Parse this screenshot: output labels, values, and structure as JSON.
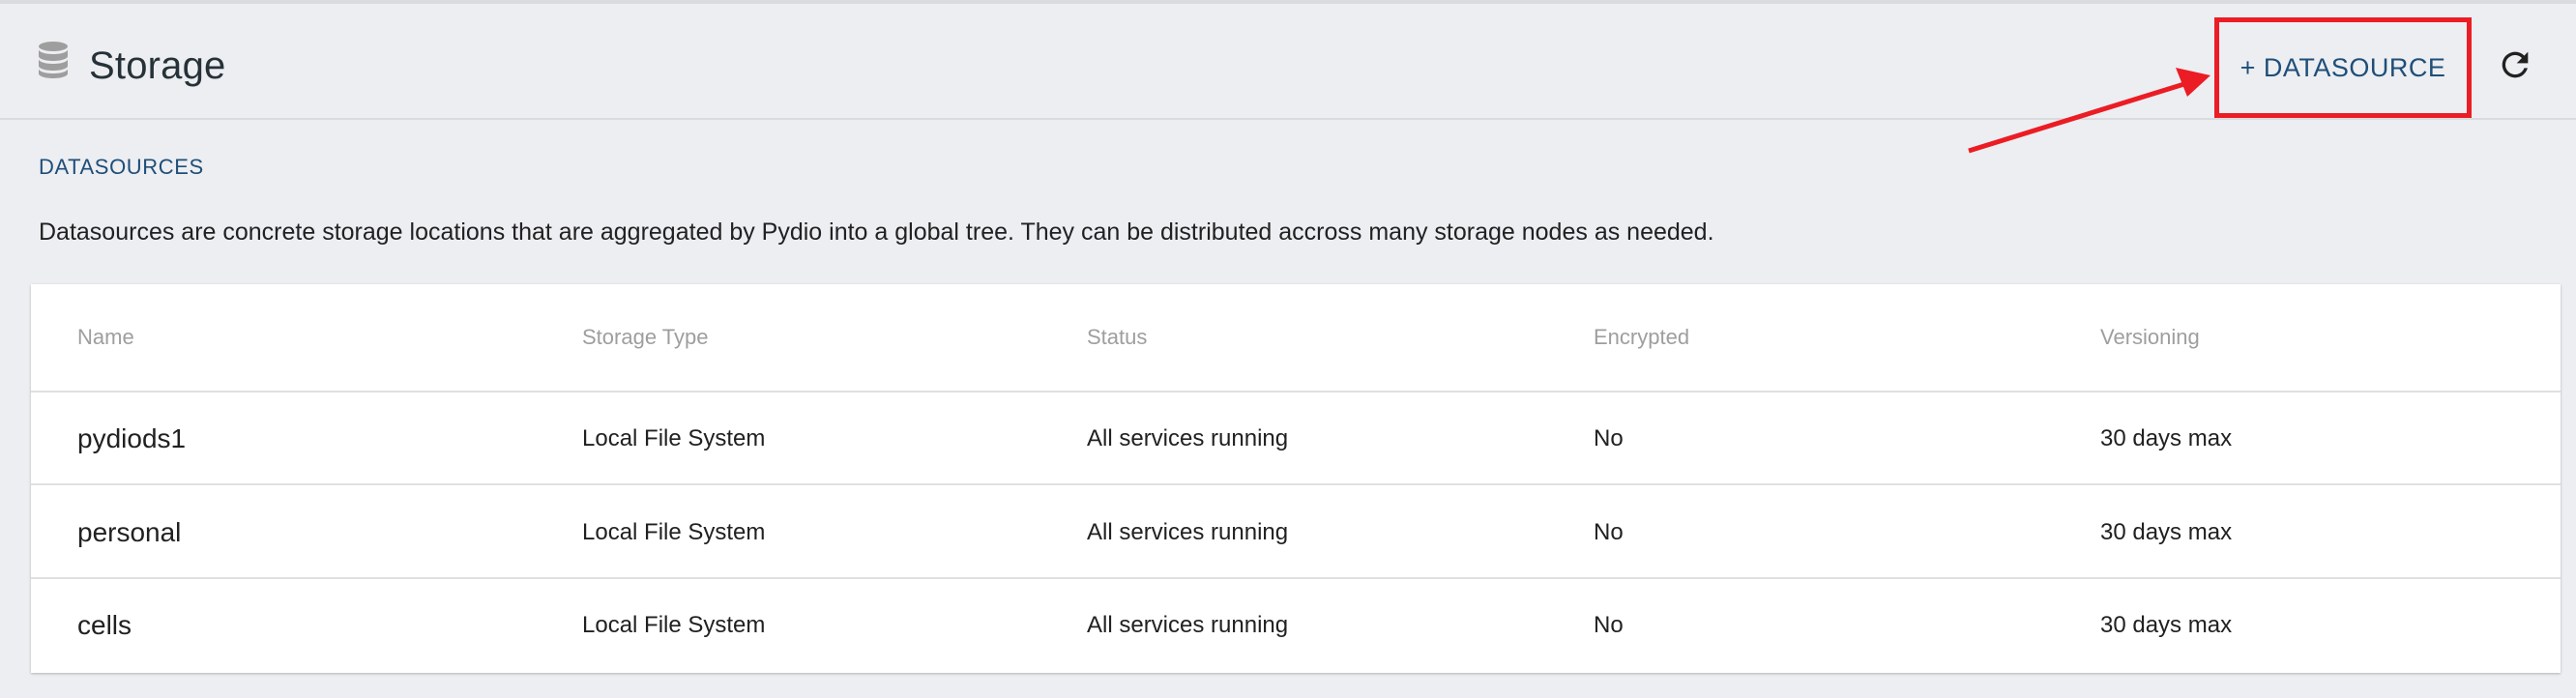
{
  "header": {
    "title": "Storage",
    "title_icon": "database-icon",
    "add_button_label": "+ DATASOURCE",
    "refresh_icon": "refresh-icon"
  },
  "section": {
    "title": "DATASOURCES",
    "description": "Datasources are concrete storage locations that are aggregated by Pydio into a global tree. They can be distributed accross many storage nodes as needed."
  },
  "table": {
    "columns": [
      "Name",
      "Storage Type",
      "Status",
      "Encrypted",
      "Versioning"
    ],
    "rows": [
      [
        "pydiods1",
        "Local File System",
        "All services running",
        "No",
        "30 days max"
      ],
      [
        "personal",
        "Local File System",
        "All services running",
        "No",
        "30 days max"
      ],
      [
        "cells",
        "Local File System",
        "All services running",
        "No",
        "30 days max"
      ]
    ]
  },
  "colors": {
    "background": "#eceef1",
    "accent": "#1f4e79",
    "highlight": "#ec1c24",
    "card": "#ffffff",
    "muted_text": "#9e9e9e"
  }
}
